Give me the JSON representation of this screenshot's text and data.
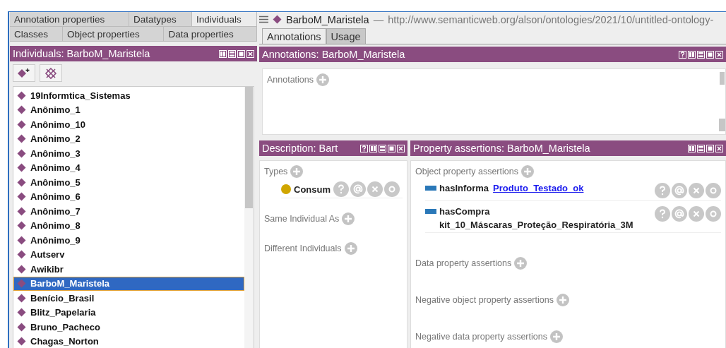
{
  "left_tabs": [
    [
      {
        "label": "Annotation properties",
        "selected": false
      },
      {
        "label": "Datatypes",
        "selected": false
      },
      {
        "label": "Individuals",
        "selected": true
      }
    ],
    [
      {
        "label": "Classes",
        "selected": false
      },
      {
        "label": "Object properties",
        "selected": false
      },
      {
        "label": "Data properties",
        "selected": false
      }
    ]
  ],
  "individuals_panel": {
    "title": "Individuals: BarboM_Maristela",
    "items": [
      {
        "label": "19Informtica_Sistemas",
        "selected": false
      },
      {
        "label": "Anônimo_1",
        "selected": false
      },
      {
        "label": "Anônimo_10",
        "selected": false
      },
      {
        "label": "Anônimo_2",
        "selected": false
      },
      {
        "label": "Anônimo_3",
        "selected": false
      },
      {
        "label": "Anônimo_4",
        "selected": false
      },
      {
        "label": "Anônimo_5",
        "selected": false
      },
      {
        "label": "Anônimo_6",
        "selected": false
      },
      {
        "label": "Anônimo_7",
        "selected": false
      },
      {
        "label": "Anônimo_8",
        "selected": false
      },
      {
        "label": "Anônimo_9",
        "selected": false
      },
      {
        "label": "Autserv",
        "selected": false
      },
      {
        "label": "Awikibr",
        "selected": false
      },
      {
        "label": "BarboM_Maristela",
        "selected": true
      },
      {
        "label": "Benício_Brasil",
        "selected": false
      },
      {
        "label": "Blitz_Papelaria",
        "selected": false
      },
      {
        "label": "Bruno_Pacheco",
        "selected": false
      },
      {
        "label": "Chagas_Norton",
        "selected": false
      }
    ]
  },
  "entity": {
    "name": "BarboM_Maristela",
    "separator": "—",
    "iri": "http://www.semanticweb.org/alson/ontologies/2021/10/untitled-ontology-"
  },
  "right_tabs": [
    {
      "label": "Annotations",
      "selected": true
    },
    {
      "label": "Usage",
      "selected": false
    }
  ],
  "annotations_panel": {
    "title": "Annotations: BarboM_Maristela",
    "section": "Annotations"
  },
  "description_panel": {
    "title": "Description: Bart",
    "sections": [
      {
        "label": "Types",
        "items": [
          "Consum"
        ]
      },
      {
        "label": "Same Individual As"
      },
      {
        "label": "Different Individuals"
      }
    ]
  },
  "property_panel": {
    "title": "Property assertions: BarboM_Maristela",
    "sections": [
      {
        "label": "Object property assertions",
        "assertions": [
          {
            "property": "hasInforma",
            "value": "Produto_Testado_ok",
            "kind": "link"
          },
          {
            "property": "hasCompra",
            "value": "kit_10_Máscaras_Proteção_Respiratória_3M",
            "kind": "wrapped"
          }
        ]
      },
      {
        "label": "Data property assertions"
      },
      {
        "label": "Negative object property assertions"
      },
      {
        "label": "Negative data property assertions"
      }
    ]
  }
}
